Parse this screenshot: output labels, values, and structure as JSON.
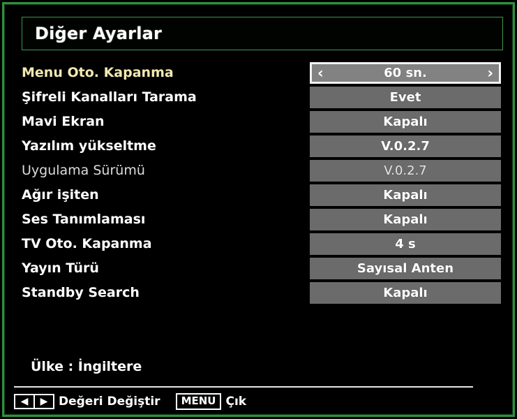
{
  "window": {
    "title": "Diğer Ayarlar"
  },
  "colors": {
    "frame_green": "#2f8f3f",
    "selected_label": "#f2e9b0",
    "value_box": "#6b6b6b",
    "selected_value_box": "#828282",
    "text_white": "#ffffff",
    "background": "#000000"
  },
  "settings": {
    "rows": [
      {
        "label": "Menu Oto. Kapanma",
        "value": "60 sn.",
        "selected": true,
        "disabled": false,
        "left_arrow": "‹",
        "right_arrow": "›"
      },
      {
        "label": "Şifreli Kanalları Tarama",
        "value": "Evet",
        "selected": false,
        "disabled": false
      },
      {
        "label": "Mavi Ekran",
        "value": "Kapalı",
        "selected": false,
        "disabled": false
      },
      {
        "label": "Yazılım yükseltme",
        "value": "V.0.2.7",
        "selected": false,
        "disabled": false
      },
      {
        "label": "Uygulama Sürümü",
        "value": "V.0.2.7",
        "selected": false,
        "disabled": true
      },
      {
        "label": "Ağır işiten",
        "value": "Kapalı",
        "selected": false,
        "disabled": false
      },
      {
        "label": "Ses Tanımlaması",
        "value": "Kapalı",
        "selected": false,
        "disabled": false
      },
      {
        "label": "TV Oto. Kapanma",
        "value": "4 s",
        "selected": false,
        "disabled": false
      },
      {
        "label": "Yayın Türü",
        "value": "Sayısal Anten",
        "selected": false,
        "disabled": false
      },
      {
        "label": "Standby Search",
        "value": "Kapalı",
        "selected": false,
        "disabled": false
      }
    ]
  },
  "status": {
    "country_line": "Ülke : İngiltere"
  },
  "footer": {
    "left_arrow_glyph": "◀",
    "right_arrow_glyph": "▶",
    "change_value_label": "Değeri Değiştir",
    "menu_key_label": "MENU",
    "exit_label": "Çık"
  }
}
